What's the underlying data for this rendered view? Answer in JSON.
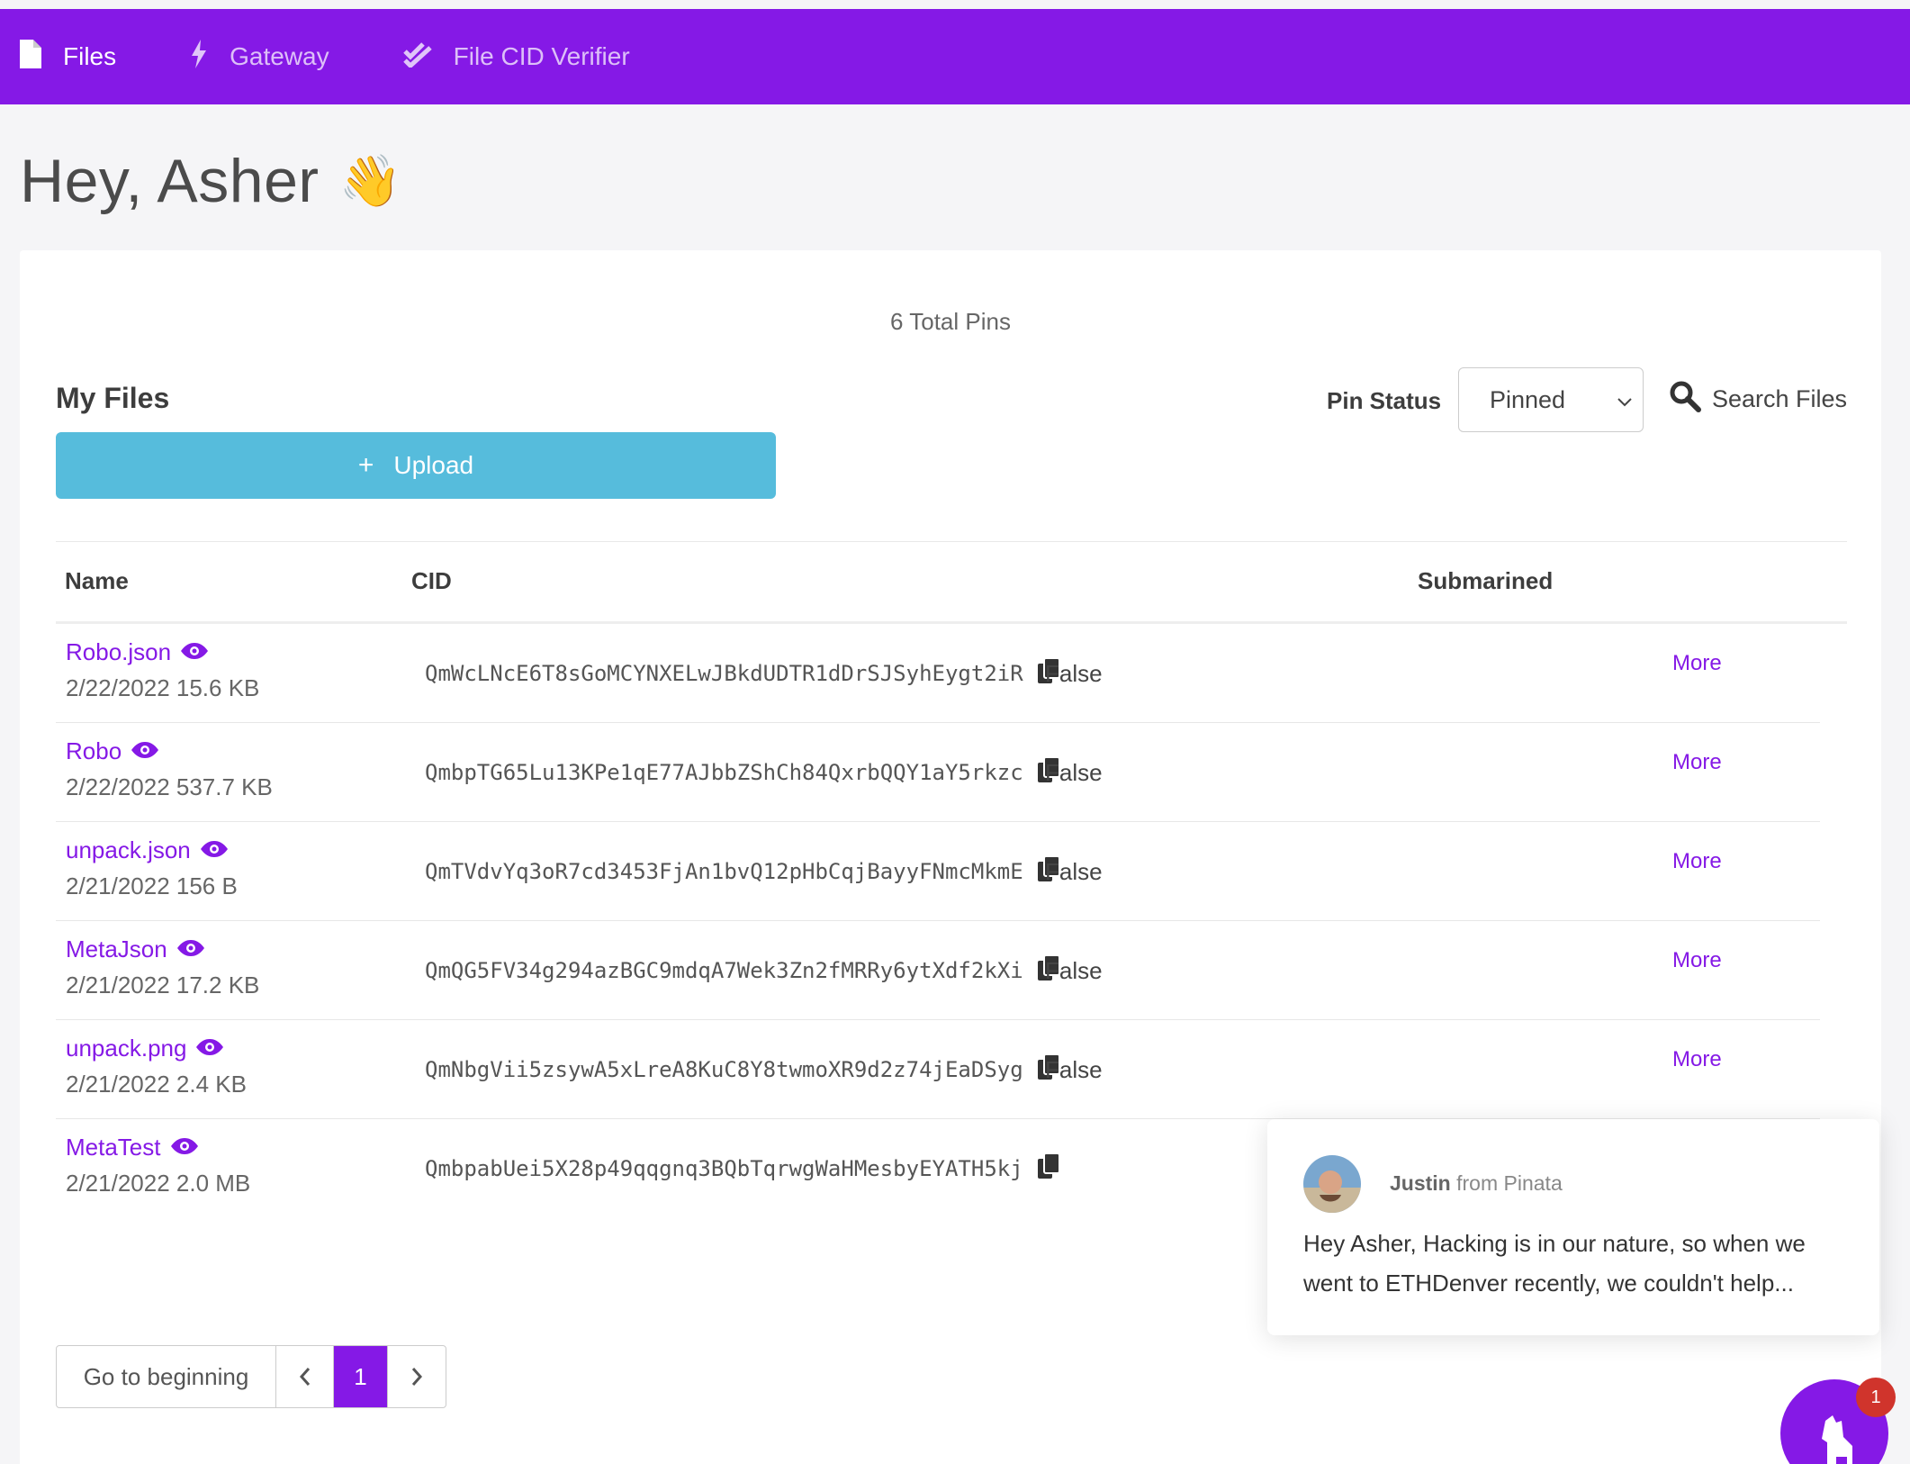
{
  "nav": {
    "items": [
      {
        "label": "Files",
        "icon": "file-icon",
        "active": true
      },
      {
        "label": "Gateway",
        "icon": "bolt-icon",
        "active": false
      },
      {
        "label": "File CID Verifier",
        "icon": "check-double-icon",
        "active": false
      }
    ]
  },
  "greeting": {
    "text": "Hey, Asher",
    "emoji": "👋"
  },
  "card": {
    "total_pins": "6 Total Pins",
    "my_files": "My Files",
    "upload_label": "Upload",
    "pin_status_label": "Pin Status",
    "pin_status_value": "Pinned",
    "search_label": "Search Files"
  },
  "table": {
    "headers": {
      "name": "Name",
      "cid": "CID",
      "submarined": "Submarined"
    },
    "rows": [
      {
        "name": "Robo.json",
        "meta": "2/22/2022 15.6 KB",
        "cid": "QmWcLNcE6T8sGoMCYNXELwJBkdUDTR1dDrSJSyhEygt2iR",
        "submarined": "False",
        "action": "More"
      },
      {
        "name": "Robo",
        "meta": "2/22/2022 537.7 KB",
        "cid": "QmbpTG65Lu13KPe1qE77AJbbZShCh84QxrbQQY1aY5rkzc",
        "submarined": "False",
        "action": "More"
      },
      {
        "name": "unpack.json",
        "meta": "2/21/2022 156 B",
        "cid": "QmTVdvYq3oR7cd3453FjAn1bvQ12pHbCqjBayyFNmcMkmE",
        "submarined": "False",
        "action": "More"
      },
      {
        "name": "MetaJson",
        "meta": "2/21/2022 17.2 KB",
        "cid": "QmQG5FV34g294azBGC9mdqA7Wek3Zn2fMRRy6ytXdf2kXi",
        "submarined": "False",
        "action": "More"
      },
      {
        "name": "unpack.png",
        "meta": "2/21/2022 2.4 KB",
        "cid": "QmNbgVii5zsywA5xLreA8KuC8Y8twmoXR9d2z74jEaDSyg",
        "submarined": "False",
        "action": "More"
      },
      {
        "name": "MetaTest",
        "meta": "2/21/2022 2.0 MB",
        "cid": "QmbpabUei5X28p49qqgnq3BQbTqrwgWaHMesbyEYATH5kj",
        "submarined": "",
        "action": ""
      }
    ]
  },
  "pagination": {
    "begin": "Go to beginning",
    "prev": "‹",
    "page": "1",
    "next": "›"
  },
  "chat": {
    "sender_name": "Justin",
    "sender_org": " from Pinata",
    "message": "Hey Asher, Hacking is in our nature, so when we went to ETHDenver recently, we couldn't help..."
  },
  "launcher": {
    "badge": "1"
  },
  "colors": {
    "brand": "#8519e6",
    "upload": "#56bcdc",
    "badge": "#d0342c"
  }
}
